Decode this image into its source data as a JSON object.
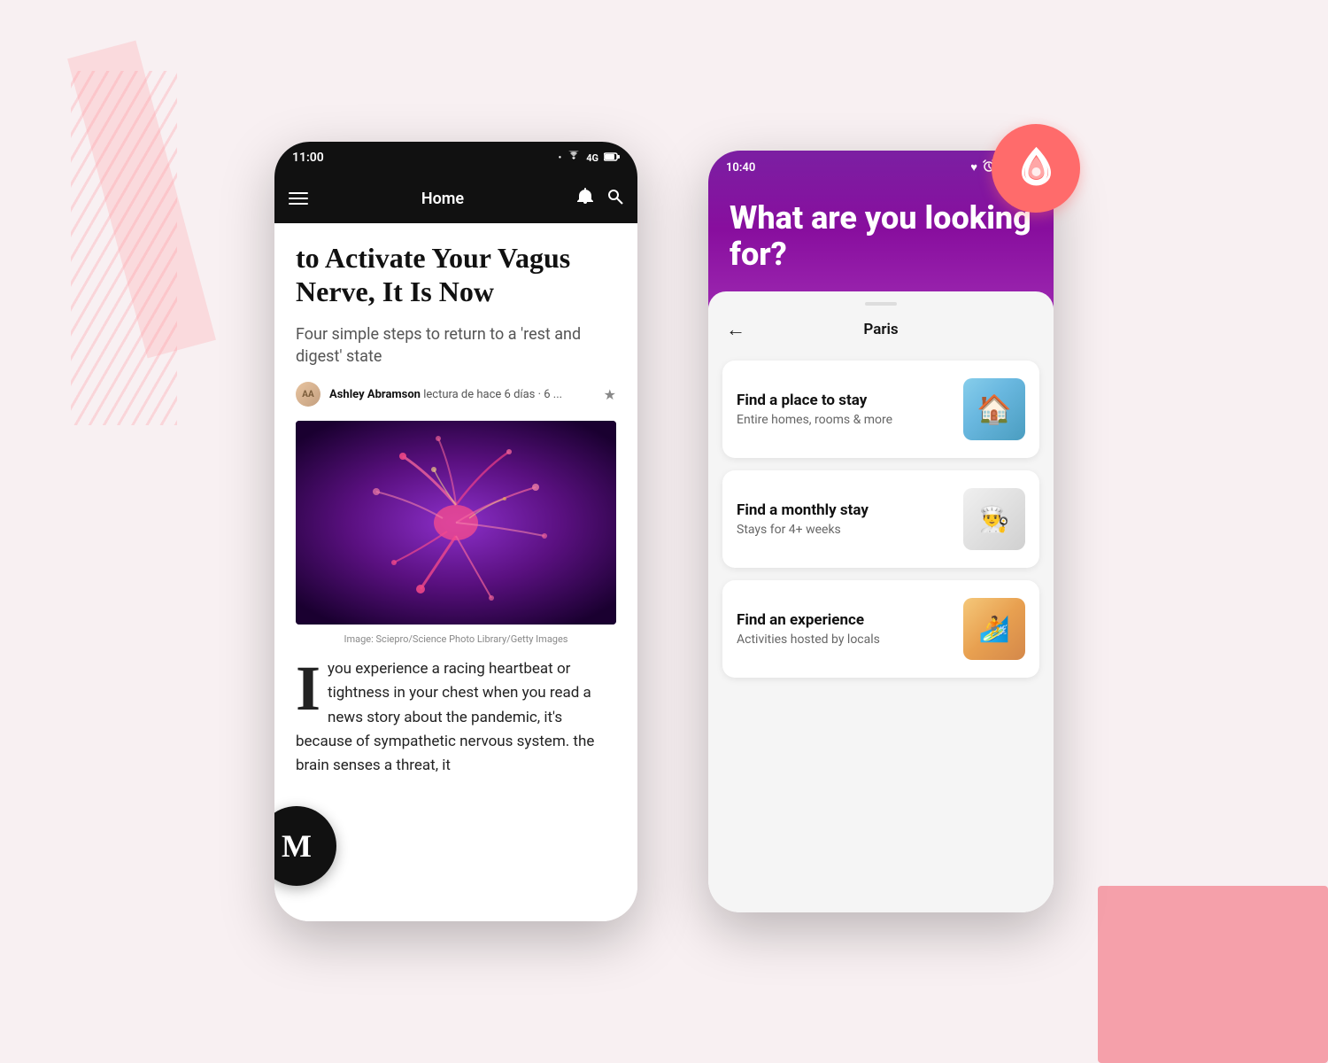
{
  "background": {
    "color": "#f8f0f2"
  },
  "medium_phone": {
    "status_bar": {
      "time": "11:00",
      "icons": [
        "signal",
        "wifi",
        "4g",
        "battery"
      ]
    },
    "nav": {
      "title": "Home",
      "has_hamburger": true,
      "has_bell": true,
      "has_search": true
    },
    "article": {
      "title": "to Activate Your Vagus Nerve, It Is Now",
      "subtitle": "Four simple steps to return to a 'rest and digest' state",
      "author": "Ashley Abramson",
      "meta": "lectura de hace 6 días · 6 ...",
      "image_caption": "Image: Sciepro/Science Photo Library/Getty Images",
      "body": "you experience a racing heartbeat or tightness in your chest when you read a news story about the pandemic, it's because of sympathetic nervous system. the brain senses a threat, it"
    },
    "logo": "M"
  },
  "airbnb_phone": {
    "status_bar": {
      "time": "10:40",
      "icons": [
        "heart",
        "alarm",
        "wifi",
        "battery"
      ]
    },
    "header": {
      "title": "What are you looking for?"
    },
    "sheet": {
      "nav_title": "Paris",
      "back_label": "←"
    },
    "cards": [
      {
        "title": "Find a place to stay",
        "subtitle": "Entire homes, rooms & more",
        "image_type": "house"
      },
      {
        "title": "Find a monthly stay",
        "subtitle": "Stays for 4+ weeks",
        "image_type": "cook"
      },
      {
        "title": "Find an experience",
        "subtitle": "Activities hosted by locals",
        "image_type": "surf"
      }
    ]
  },
  "airbnb_logo": {
    "color": "#ff6b6b"
  }
}
